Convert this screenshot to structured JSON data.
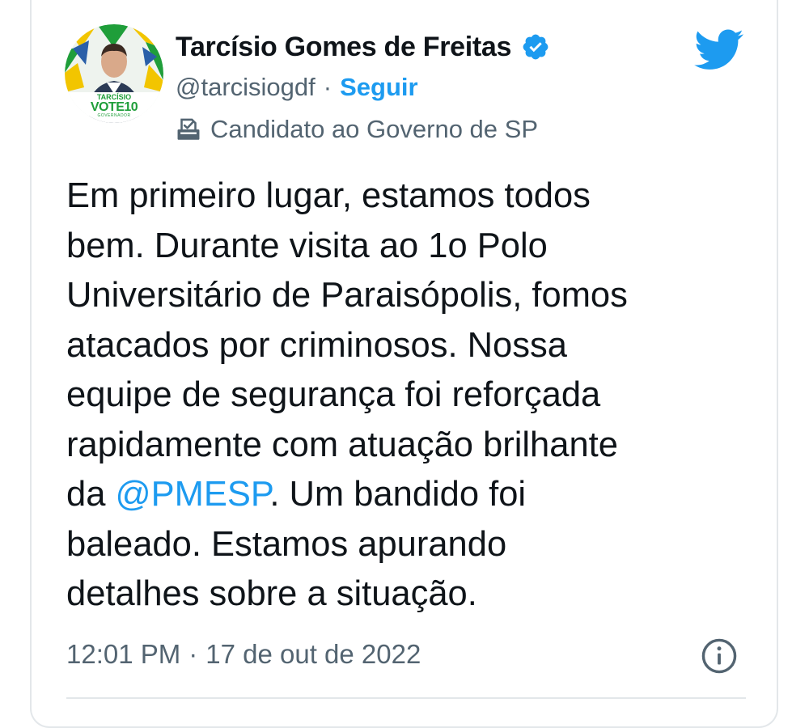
{
  "tweet": {
    "author": {
      "name": "Tarcísio Gomes de Freitas",
      "handle": "@tarcisiogdf",
      "separator": "·",
      "follow_label": "Seguir",
      "affiliation_label": "Candidato ao Governo de SP",
      "avatar_badge": {
        "line1": "TARCÍSIO",
        "line2": "VOTE10",
        "line3": "GOVERNADOR"
      },
      "verified": true
    },
    "text_parts": {
      "before_mention": "Em primeiro lugar, estamos todos\nbem. Durante visita ao 1o Polo\nUniversitário de Paraisópolis, fomos\natacados por criminosos. Nossa\nequipe de segurança foi reforçada\nrapidamente com atuação brilhante\nda ",
      "mention": "@PMESP",
      "after_mention": ". Um bandido foi\nbaleado. Estamos apurando\ndetalhes sobre a situação."
    },
    "time": "12:01 PM",
    "meta_separator": "·",
    "date": "17 de out de 2022"
  },
  "icons": {
    "brand": "twitter-bird-icon",
    "verified": "verified-badge-icon",
    "affiliation": "ballot-box-icon",
    "info": "info-icon"
  },
  "colors": {
    "brand_blue": "#1d9bf0",
    "text_primary": "#0f1419",
    "text_secondary": "#536471",
    "border": "#e3e7ea",
    "avatar_green": "#1f9e3a",
    "avatar_yellow": "#f2c500"
  }
}
